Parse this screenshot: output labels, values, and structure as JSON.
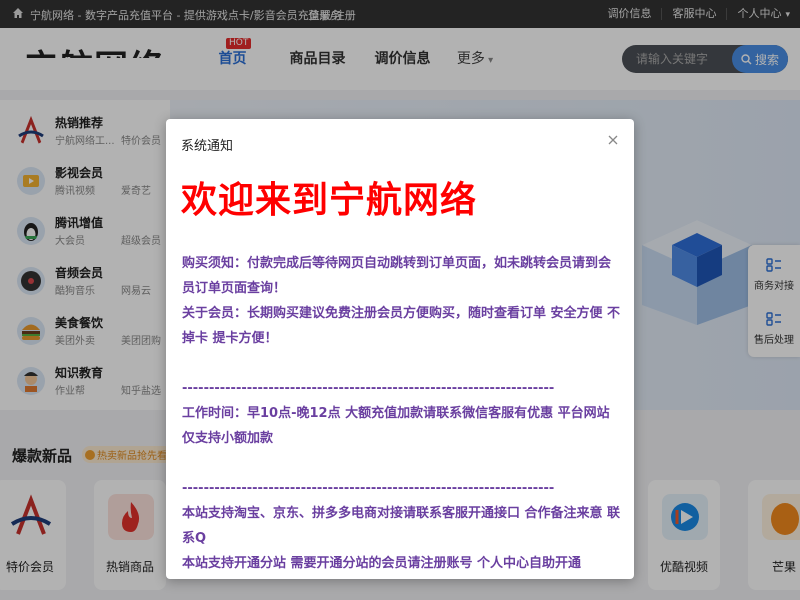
{
  "topbar": {
    "site_desc": "宁航网络 - 数字产品充值平台 - 提供游戏点卡/影音会员充值服务",
    "login": "登录/注册",
    "links": [
      "调价信息",
      "客服中心",
      "个人中心"
    ]
  },
  "header": {
    "logo_text": "宁航网络",
    "nav": [
      "首页",
      "商品目录",
      "调价信息",
      "更多"
    ],
    "hot_badge": "HOT",
    "search_placeholder": "请输入关键字",
    "search_button": "搜索"
  },
  "categories": [
    {
      "title": "热销推荐",
      "sub1": "宁航网络工...",
      "sub2": "特价会员"
    },
    {
      "title": "影视会员",
      "sub1": "腾讯视频",
      "sub2": "爱奇艺"
    },
    {
      "title": "腾讯增值",
      "sub1": "大会员",
      "sub2": "超级会员"
    },
    {
      "title": "音频会员",
      "sub1": "酷狗音乐",
      "sub2": "网易云"
    },
    {
      "title": "美食餐饮",
      "sub1": "美团外卖",
      "sub2": "美团团购"
    },
    {
      "title": "知识教育",
      "sub1": "作业帮",
      "sub2": "知乎盐选"
    }
  ],
  "side_tools": [
    "商务对接",
    "售后处理"
  ],
  "new_products": {
    "title": "爆款新品",
    "tag": "热卖新品抢先看",
    "items": [
      "特价会员",
      "热销商品",
      "优酷视频",
      "芒果"
    ]
  },
  "modal": {
    "title": "系统通知",
    "headline": "欢迎来到宁航网络",
    "p1": " 购买须知：付款完成后等待网页自动跳转到订单页面，如未跳转会员请到会员订单页面查询！",
    "p2": " 关于会员：长期购买建议免费注册会员方便购买，随时查看订单 安全方便 不掉卡 提卡方便！",
    "dash1": " ---------------------------------------------------------------------",
    "p3": " 工作时间：早10点-晚12点 大额充值加款请联系微信客服有优惠 平台网站仅支持小额加款",
    "dash2": " ---------------------------------------------------------------------",
    "p4": " 本站支持淘宝、京东、拼多多电商对接请联系客服开通接口 合作备注来意 联系Q",
    "p5": " 本站支持开通分站 需要开通分站的会员请注册账号 个人中心自助开通"
  },
  "colors": {
    "accent": "#2a6fd6",
    "headline": "#ff0000",
    "notice_text": "#6a3fa0",
    "hot": "#e52b2b"
  }
}
